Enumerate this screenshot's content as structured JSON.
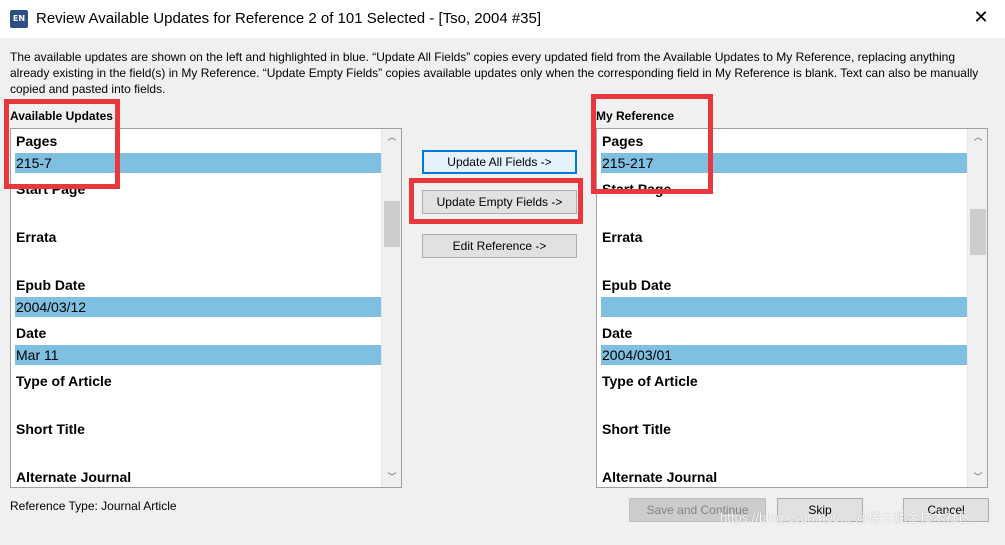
{
  "window": {
    "app_icon": "EN",
    "title": "Review Available Updates for Reference 2 of 101 Selected - [Tso, 2004 #35]",
    "close_icon": "✕"
  },
  "description": "The available updates are shown on the left and highlighted in blue. “Update All Fields” copies every updated field from the Available Updates to My Reference, replacing anything already existing in the field(s) in My Reference. “Update Empty Fields” copies available updates only when the corresponding field in My Reference is blank. Text can also be manually copied and pasted into fields.",
  "available": {
    "label": "Available Updates",
    "fields": [
      {
        "name": "Pages",
        "value": "215-7",
        "highlighted": true
      },
      {
        "name": "Start Page",
        "value": "",
        "highlighted": false
      },
      {
        "name": "Errata",
        "value": "",
        "highlighted": false
      },
      {
        "name": "Epub Date",
        "value": "2004/03/12",
        "highlighted": true
      },
      {
        "name": "Date",
        "value": "Mar 11",
        "highlighted": true
      },
      {
        "name": "Type of Article",
        "value": "",
        "highlighted": false
      },
      {
        "name": "Short Title",
        "value": "",
        "highlighted": false
      },
      {
        "name": "Alternate Journal",
        "value": "",
        "highlighted": false
      }
    ]
  },
  "mine": {
    "label": "My Reference",
    "fields": [
      {
        "name": "Pages",
        "value": "215-217",
        "highlighted": true
      },
      {
        "name": "Start Page",
        "value": "",
        "highlighted": false
      },
      {
        "name": "Errata",
        "value": "",
        "highlighted": false
      },
      {
        "name": "Epub Date",
        "value": "",
        "highlighted": true
      },
      {
        "name": "Date",
        "value": "2004/03/01",
        "highlighted": true
      },
      {
        "name": "Type of Article",
        "value": "",
        "highlighted": false
      },
      {
        "name": "Short Title",
        "value": "",
        "highlighted": false
      },
      {
        "name": "Alternate Journal",
        "value": "",
        "highlighted": false
      }
    ]
  },
  "actions": {
    "update_all": "Update All Fields ->",
    "update_empty": "Update Empty Fields ->",
    "edit_reference": "Edit Reference ->"
  },
  "footer": {
    "reference_type": "Reference Type: Journal Article",
    "save_continue": "Save and Continue",
    "skip": "Skip",
    "cancel": "Cancel"
  },
  "watermark": "https://blog.csdn.net/...  @稀土掘金技术社区",
  "colors": {
    "highlight": "#7fbfdf",
    "annotation_red": "#e8383d",
    "focus_blue": "#0078d7"
  }
}
